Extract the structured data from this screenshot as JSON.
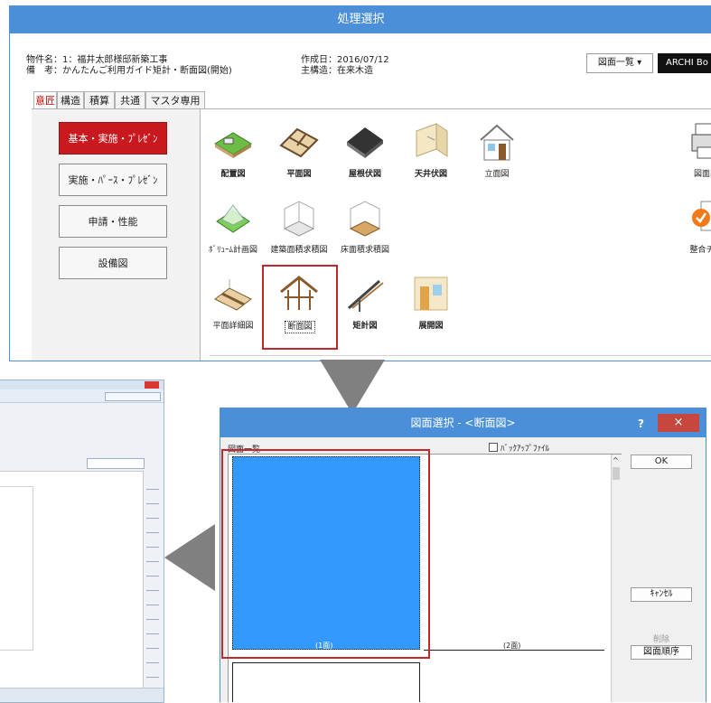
{
  "top_window": {
    "title": "処理選択",
    "info_labels": {
      "property_name": "物件名：1：福井太郎様邸新築工事",
      "remarks": "備　考：かんたんご利用ガイド矩計・断面図(開始)",
      "created": "作成日：2016/07/12",
      "structure": "主構造：在来木造"
    },
    "drawing_list_button": "図面一覧 ▾",
    "archi_button": "ARCHI Bo",
    "tabs": [
      "意匠",
      "構造",
      "積算",
      "共通",
      "マスタ専用"
    ],
    "active_tab": "意匠",
    "side_buttons": [
      "基本・実施・ﾌﾟﾚｾﾞﾝ",
      "実施・ﾊﾟｰｽ・ﾌﾟﾚｾﾞﾝ",
      "申請・性能",
      "設備図"
    ],
    "active_side": "基本・実施・ﾌﾟﾚｾﾞﾝ",
    "icons": [
      {
        "label": "配置図",
        "bold": true,
        "icon": "site-plan-icon"
      },
      {
        "label": "平面図",
        "bold": true,
        "icon": "floor-plan-icon"
      },
      {
        "label": "屋根伏図",
        "bold": true,
        "icon": "roof-plan-icon"
      },
      {
        "label": "天井伏図",
        "bold": true,
        "icon": "ceiling-plan-icon"
      },
      {
        "label": "立面図",
        "bold": false,
        "icon": "elevation-icon"
      },
      {
        "label": "図面印刷",
        "bold": false,
        "icon": "print-icon"
      },
      {
        "label": "ﾎﾞﾘｭｰﾑ計画図",
        "bold": false,
        "icon": "volume-plan-icon"
      },
      {
        "label": "建築面積求積図",
        "bold": false,
        "icon": "building-area-icon"
      },
      {
        "label": "床面積求積図",
        "bold": false,
        "icon": "floor-area-icon"
      },
      {
        "label": "整合チェッ",
        "bold": false,
        "icon": "check-icon"
      },
      {
        "label": "平面詳細図",
        "bold": false,
        "icon": "plan-detail-icon"
      },
      {
        "label": "断面図",
        "bold": false,
        "icon": "section-icon"
      },
      {
        "label": "矩計図",
        "bold": true,
        "icon": "sectional-detail-icon"
      },
      {
        "label": "展開図",
        "bold": false,
        "icon": "interior-elevation-icon"
      }
    ]
  },
  "dialog": {
    "title": "図面選択 - <断面図>",
    "help": "?",
    "close": "×",
    "list_label": "図面一覧",
    "backup_label": "ﾊﾞｯｸｱｯﾌﾟﾌｧｲﾙ",
    "ok": "OK",
    "cancel": "ｷｬﾝｾﾙ",
    "delete": "削除",
    "order": "図面順序",
    "sheets": [
      "(1面)",
      "(2面)"
    ]
  },
  "colors": {
    "title_blue": "#4a8fd8",
    "active_red": "#c8191f",
    "highlight_red": "#c0282e",
    "selected_blue": "#3399ff",
    "arrow_gray": "#808080"
  }
}
